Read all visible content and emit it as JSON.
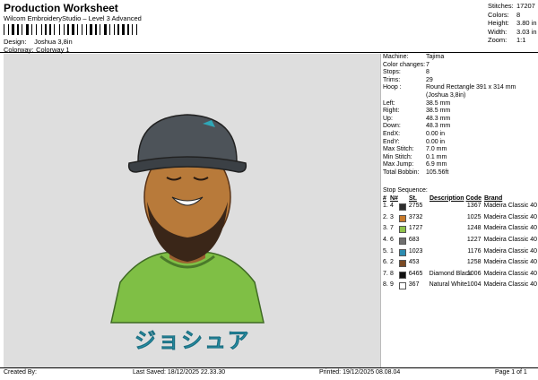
{
  "header": {
    "title": "Production Worksheet",
    "subtitle": "Wilcom EmbroideryStudio – Level 3 Advanced",
    "design_label": "Design:",
    "design_value": "Joshua 3,8in",
    "colorway_label": "Colorway:",
    "colorway_value": "Colorway 1"
  },
  "summary": {
    "stitches_label": "Stitches:",
    "stitches": "17207",
    "colors_label": "Colors:",
    "colors": "8",
    "height_label": "Height:",
    "height": "3.80 in",
    "width_label": "Width:",
    "width": "3.03 in",
    "zoom_label": "Zoom:",
    "zoom": "1:1"
  },
  "design_text": "ジョシュア",
  "info": [
    {
      "k": "Machine:",
      "v": "Tajima"
    },
    {
      "k": "Color changes:",
      "v": "7"
    },
    {
      "k": "Stops:",
      "v": "8"
    },
    {
      "k": "Trims:",
      "v": "29"
    },
    {
      "k": "Hoop :",
      "v": "Round Rectangle 391 x 314 mm (Joshua 3,8in)"
    },
    {
      "k": "Left:",
      "v": "38.5 mm"
    },
    {
      "k": "Right:",
      "v": "38.5 mm"
    },
    {
      "k": "Up:",
      "v": "48.3 mm"
    },
    {
      "k": "Down:",
      "v": "48.3 mm"
    },
    {
      "k": "EndX:",
      "v": "0.00 in"
    },
    {
      "k": "EndY:",
      "v": "0.00 in"
    },
    {
      "k": "Max Stitch:",
      "v": "7.0 mm"
    },
    {
      "k": "Min Stitch:",
      "v": "0.1 mm"
    },
    {
      "k": "Max Jump:",
      "v": "6.9 mm"
    },
    {
      "k": "Total Bobbin:",
      "v": "105.56ft"
    }
  ],
  "stop_sequence": {
    "label": "Stop Sequence:",
    "headers": [
      "#",
      "N#",
      "",
      "St.",
      "Description",
      "Code",
      "Brand"
    ],
    "rows": [
      {
        "n": "1.",
        "nn": "4",
        "color": "#2e2e2e",
        "code_num": "2755",
        "desc": "",
        "st": "1367",
        "brand": "Madeira Classic 40"
      },
      {
        "n": "2.",
        "nn": "3",
        "color": "#c87a2a",
        "code_num": "3732",
        "desc": "",
        "st": "1025",
        "brand": "Madeira Classic 40"
      },
      {
        "n": "3.",
        "nn": "7",
        "color": "#8fc24a",
        "code_num": "1727",
        "desc": "",
        "st": "1248",
        "brand": "Madeira Classic 40"
      },
      {
        "n": "4.",
        "nn": "6",
        "color": "#6f6f6f",
        "code_num": "683",
        "desc": "",
        "st": "1227",
        "brand": "Madeira Classic 40"
      },
      {
        "n": "5.",
        "nn": "1",
        "color": "#2c8cb0",
        "code_num": "1023",
        "desc": "",
        "st": "1176",
        "brand": "Madeira Classic 40"
      },
      {
        "n": "6.",
        "nn": "2",
        "color": "#7a4a24",
        "code_num": "453",
        "desc": "",
        "st": "1258",
        "brand": "Madeira Classic 40"
      },
      {
        "n": "7.",
        "nn": "8",
        "color": "#111111",
        "code_num": "6465",
        "desc": "Diamond Black",
        "st": "1006",
        "brand": "Madeira Classic 40"
      },
      {
        "n": "8.",
        "nn": "9",
        "color": "#ffffff",
        "code_num": "367",
        "desc": "Natural White",
        "st": "1004",
        "brand": "Madeira Classic 40"
      }
    ]
  },
  "footer": {
    "created": "Created By:",
    "last_saved": "Last Saved: 18/12/2025 22.33.30",
    "printed": "Printed: 19/12/2025 08.08.04",
    "page": "Page 1 of 1"
  }
}
